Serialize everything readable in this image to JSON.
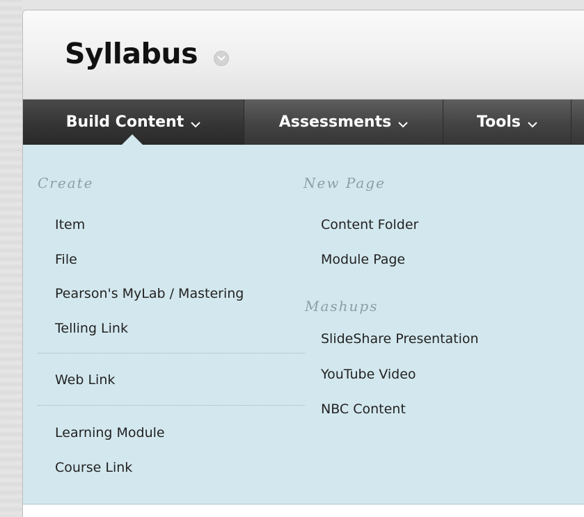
{
  "page": {
    "title": "Syllabus"
  },
  "nav": {
    "tabs": [
      {
        "label": "Build Content"
      },
      {
        "label": "Assessments"
      },
      {
        "label": "Tools"
      }
    ]
  },
  "menu": {
    "create": {
      "heading": "Create",
      "items": [
        "Item",
        "File",
        "Pearson's MyLab / Mastering",
        "Telling Link",
        "Web Link",
        "Learning Module",
        "Course Link"
      ]
    },
    "new_page": {
      "heading": "New Page",
      "items": [
        "Content Folder",
        "Module Page"
      ]
    },
    "mashups": {
      "heading": "Mashups",
      "items": [
        "SlideShare Presentation",
        "YouTube Video",
        "NBC Content"
      ]
    }
  },
  "icons": {
    "title_menu": "chevron-down-circle-icon",
    "tab_caret": "chevron-down-icon"
  },
  "colors": {
    "nav_bar": "#434343",
    "dropdown_bg": "#d3e8ee",
    "section_heading": "#8b9ea6",
    "menu_text": "#222222"
  }
}
